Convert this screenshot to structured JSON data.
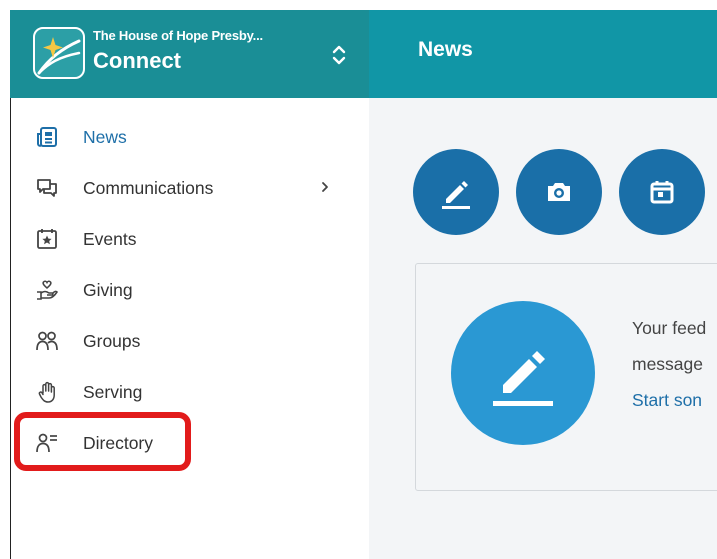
{
  "header": {
    "org_name": "The House of Hope Presby...",
    "app_name": "Connect",
    "page_title": "News"
  },
  "sidebar": {
    "items": [
      {
        "label": "News",
        "icon": "newspaper-icon",
        "active": true
      },
      {
        "label": "Communications",
        "icon": "chat-bubbles-icon",
        "has_submenu": true
      },
      {
        "label": "Events",
        "icon": "star-calendar-icon"
      },
      {
        "label": "Giving",
        "icon": "heart-hand-icon"
      },
      {
        "label": "Groups",
        "icon": "people-icon"
      },
      {
        "label": "Serving",
        "icon": "raised-hand-icon"
      },
      {
        "label": "Directory",
        "icon": "person-list-icon",
        "highlighted": true
      }
    ]
  },
  "main": {
    "actions": [
      {
        "icon": "pencil-icon"
      },
      {
        "icon": "camera-icon"
      },
      {
        "icon": "calendar-icon"
      }
    ],
    "feed_empty": {
      "line1": "Your feed",
      "line2": "message",
      "link": "Start son"
    }
  },
  "colors": {
    "header_teal": "#1a8e96",
    "topbar_teal": "#1196a6",
    "action_blue": "#1a6fa8",
    "feed_icon_blue": "#2a98d3",
    "highlight_red": "#e21b1b",
    "active_blue": "#1e6fa8"
  }
}
